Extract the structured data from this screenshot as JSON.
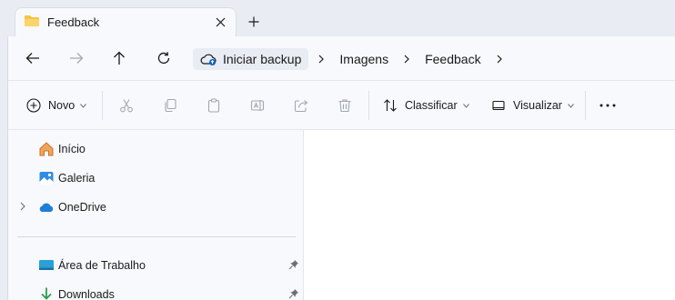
{
  "tab": {
    "title": "Feedback"
  },
  "breadcrumb": {
    "root": "Iniciar backup",
    "items": [
      "Imagens",
      "Feedback"
    ]
  },
  "toolbar": {
    "new_label": "Novo",
    "sort_label": "Classificar",
    "view_label": "Visualizar"
  },
  "sidebar": {
    "items": [
      {
        "label": "Início",
        "icon": "home-icon"
      },
      {
        "label": "Galeria",
        "icon": "gallery-icon"
      },
      {
        "label": "OneDrive",
        "icon": "onedrive-icon"
      }
    ],
    "quick_access": [
      {
        "label": "Área de Trabalho",
        "icon": "desktop-icon"
      },
      {
        "label": "Downloads",
        "icon": "downloads-icon"
      }
    ]
  },
  "colors": {
    "accent": "#0a63c2",
    "folder": "#f6c343",
    "cloud": "#1e7fd6",
    "home": "#e08a3c",
    "download": "#2a9d4b"
  }
}
